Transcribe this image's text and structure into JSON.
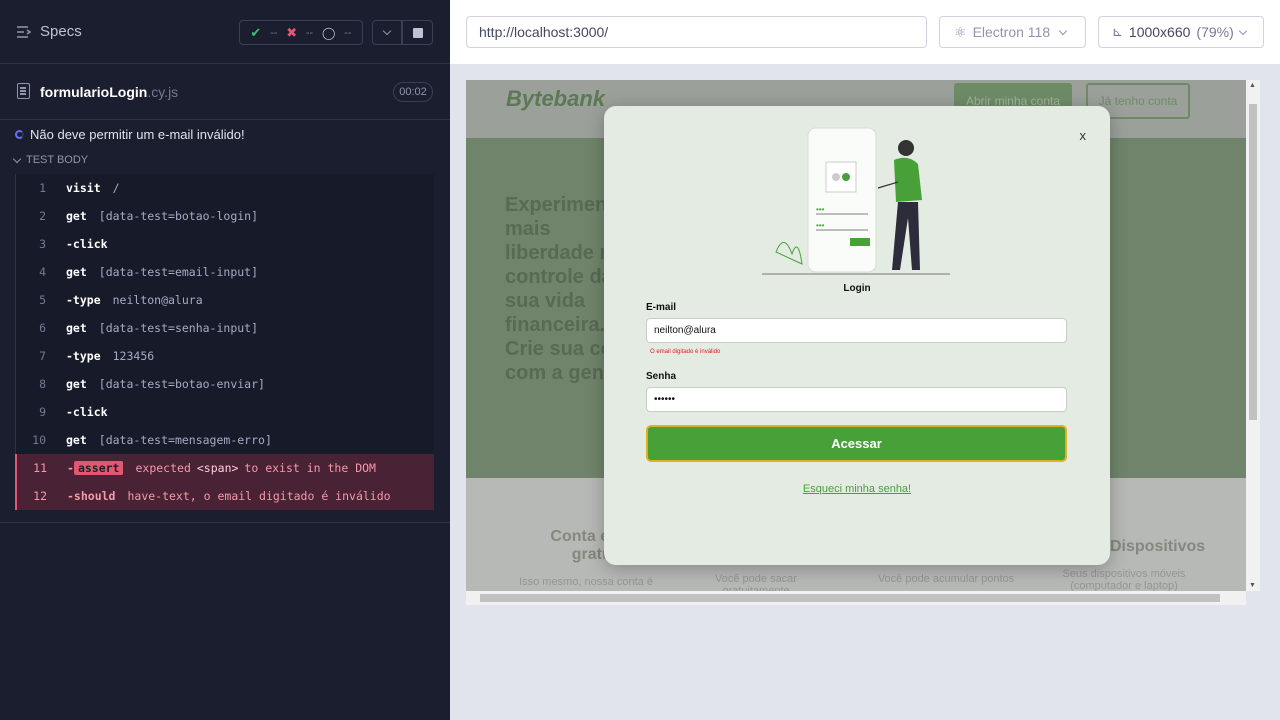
{
  "runner": {
    "specs_label": "Specs",
    "stats": {
      "passed": "--",
      "failed": "--",
      "pending": "--"
    },
    "file_name": "formularioLogin",
    "file_ext": ".cy.js",
    "duration": "00:02",
    "test_title": "Não deve permitir um e-mail inválido!",
    "section_label": "TEST BODY",
    "commands": [
      {
        "num": "1",
        "name": "visit",
        "msg": "/"
      },
      {
        "num": "2",
        "name": "get",
        "msg": "[data-test=botao-login]"
      },
      {
        "num": "3",
        "name": "-click",
        "msg": ""
      },
      {
        "num": "4",
        "name": "get",
        "msg": "[data-test=email-input]"
      },
      {
        "num": "5",
        "name": "-type",
        "msg": "neilton@alura"
      },
      {
        "num": "6",
        "name": "get",
        "msg": "[data-test=senha-input]"
      },
      {
        "num": "7",
        "name": "-type",
        "msg": "123456"
      },
      {
        "num": "8",
        "name": "get",
        "msg": "[data-test=botao-enviar]"
      },
      {
        "num": "9",
        "name": "-click",
        "msg": ""
      },
      {
        "num": "10",
        "name": "get",
        "msg": "[data-test=mensagem-erro]"
      }
    ],
    "error_commands": [
      {
        "num": "11",
        "prefix": "-",
        "tag": "assert",
        "msg_a": "expected",
        "msg_el": "<span>",
        "msg_b": "to exist in the DOM"
      },
      {
        "num": "12",
        "name": "-should",
        "msg": "have-text, o email digitado é inválido"
      }
    ]
  },
  "browser_bar": {
    "url": "http://localhost:3000/",
    "browser": "Electron 118",
    "viewport": "1000x660",
    "zoom": "(79%)"
  },
  "app": {
    "logo": "Bytebank",
    "header_btn_open": "Abrir minha conta",
    "header_btn_have": "Já tenho conta",
    "hero_text": "Experimente mais liberdade no controle da sua vida financeira. Crie sua conta com a gente!",
    "features": [
      {
        "title": "Conta e cartão gratuitos",
        "desc": "Isso mesmo, nossa conta é"
      },
      {
        "title": "",
        "desc": "Você pode sacar gratuitamente"
      },
      {
        "title": "",
        "desc": "Você pode acumular pontos"
      },
      {
        "title": "Dispositivos",
        "desc": "Seus dispositivos móveis (computador e laptop)"
      }
    ],
    "modal": {
      "close": "x",
      "title": "Login",
      "email_label": "E-mail",
      "email_value": "neilton@alura",
      "email_error": "O email digitado é inválido",
      "password_label": "Senha",
      "password_value": "••••••",
      "submit_label": "Acessar",
      "forgot_label": "Esqueci minha senha!"
    }
  },
  "colors": {
    "accent_green": "#47a138",
    "error_red": "#e45770",
    "runner_bg": "#1b1e2e"
  }
}
